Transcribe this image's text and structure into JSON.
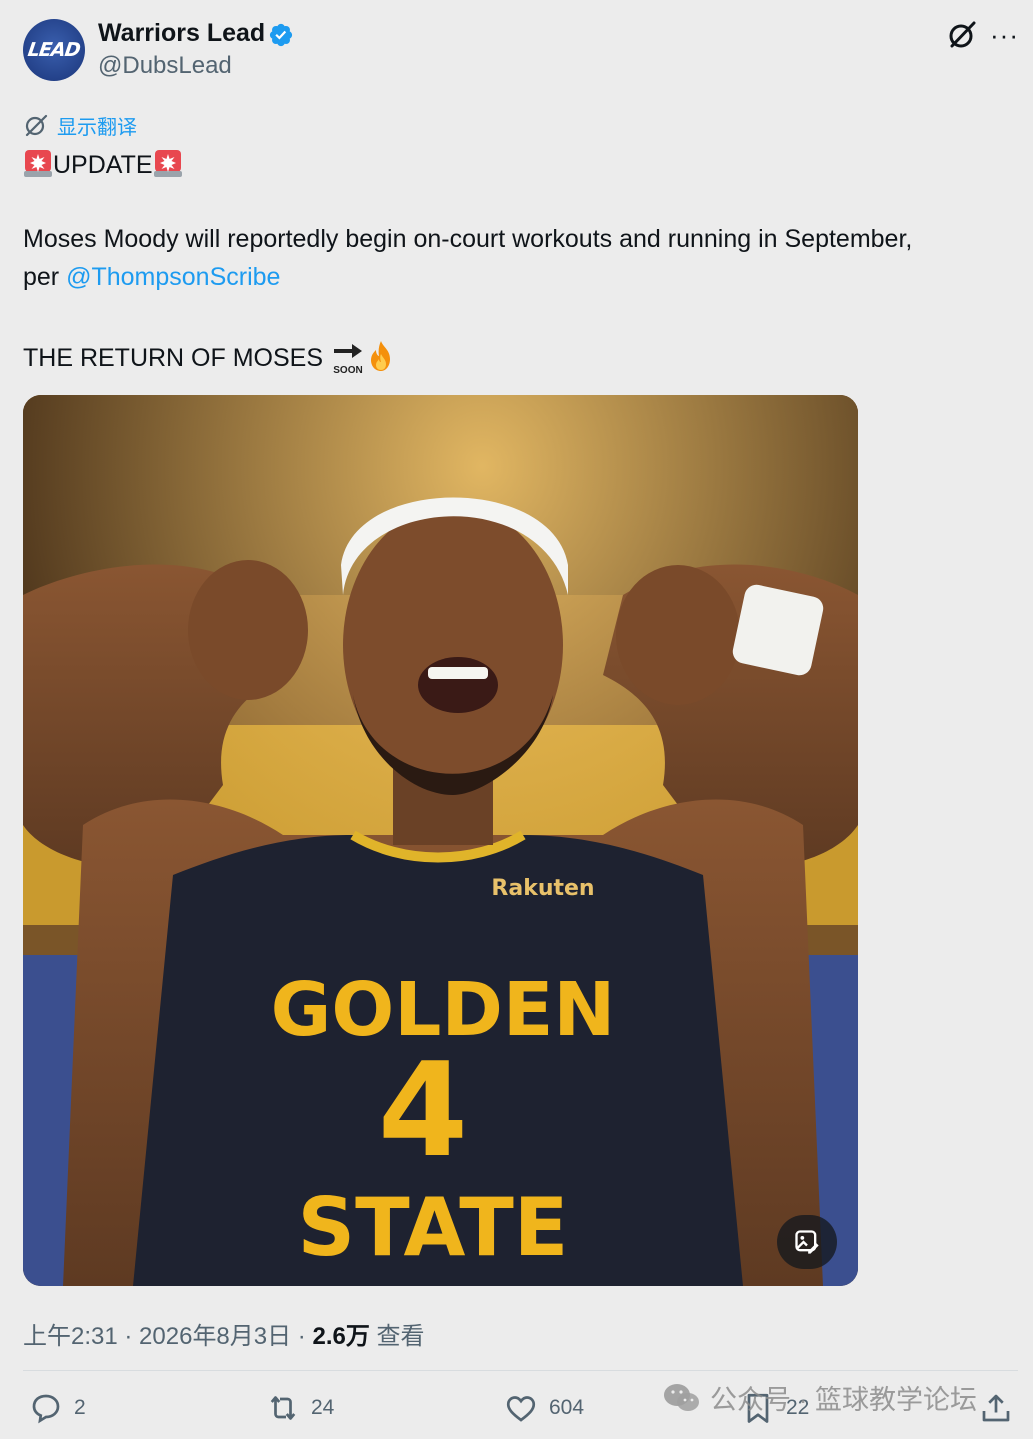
{
  "author": {
    "display_name": "Warriors Lead",
    "handle": "@DubsLead",
    "avatar_text": "LEAD"
  },
  "icons": {
    "verified": "verified-badge-icon",
    "grok": "grok-icon",
    "more": "more-icon",
    "translate": "translate-icon",
    "reply": "reply-icon",
    "retweet": "retweet-icon",
    "like": "like-icon",
    "bookmark": "bookmark-icon",
    "share": "share-icon",
    "alt": "image-alt-icon"
  },
  "more_label": "···",
  "translate_label": "显示翻译",
  "tweet": {
    "update_text": "UPDATE",
    "line1": "Moses Moody will reportedly begin on-court workouts and running in September,",
    "line2_prefix": "per ",
    "mention": "@ThompsonScribe",
    "line3": "THE RETURN OF MOSES",
    "soon_label": "SOON"
  },
  "meta": {
    "time": "上午2:31",
    "sep1": " · ",
    "date": "2026年8月3日",
    "sep2": " · ",
    "views": "2.6万",
    "views_label": " 查看"
  },
  "actions": {
    "replies": "2",
    "retweets": "24",
    "likes": "604",
    "bookmarks": "22"
  },
  "watermark": "公众号 · 篮球教学论坛",
  "colors": {
    "accent": "#1d9bf0",
    "text": "#0f1419",
    "muted": "#536471",
    "background": "#ececec"
  }
}
